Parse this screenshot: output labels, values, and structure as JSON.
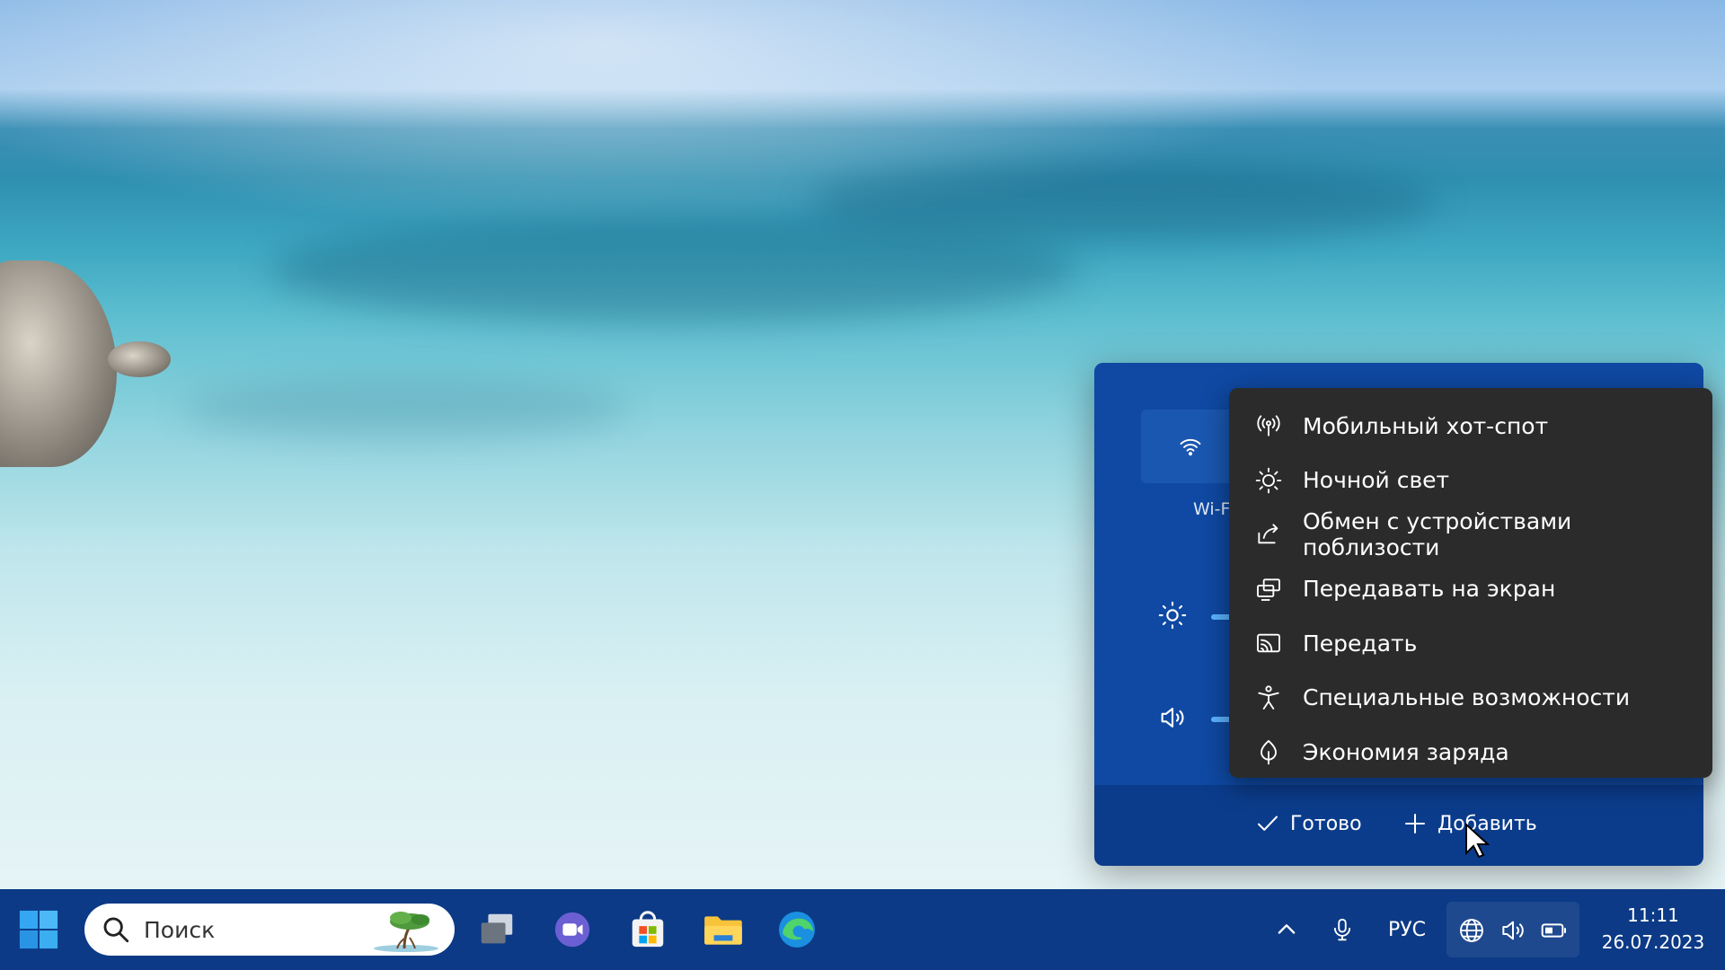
{
  "quick_settings": {
    "wifi_label": "Wi-Fi",
    "footer": {
      "done_label": "Готово",
      "add_label": "Добавить"
    }
  },
  "add_menu": {
    "items": [
      {
        "label": "Мобильный хот-спот",
        "icon": "hotspot-icon"
      },
      {
        "label": "Ночной свет",
        "icon": "night-light-icon"
      },
      {
        "label": "Обмен с устройствами поблизости",
        "icon": "nearby-share-icon"
      },
      {
        "label": "Передавать на экран",
        "icon": "project-icon"
      },
      {
        "label": "Передать",
        "icon": "cast-icon"
      },
      {
        "label": "Специальные возможности",
        "icon": "accessibility-icon"
      },
      {
        "label": "Экономия заряда",
        "icon": "battery-saver-icon"
      }
    ]
  },
  "taskbar": {
    "search_placeholder": "Поиск",
    "apps": [
      "task-view-icon",
      "teams-icon",
      "store-icon",
      "file-explorer-icon",
      "edge-icon"
    ],
    "tray": {
      "language": "РУС"
    },
    "clock": {
      "time": "11:11",
      "date": "26.07.2023"
    }
  },
  "colors": {
    "taskbar_bg": "#0c3a86",
    "panel_bg": "#0f49a3",
    "menu_bg": "#2b2b2b",
    "accent": "#5cb4ff"
  }
}
